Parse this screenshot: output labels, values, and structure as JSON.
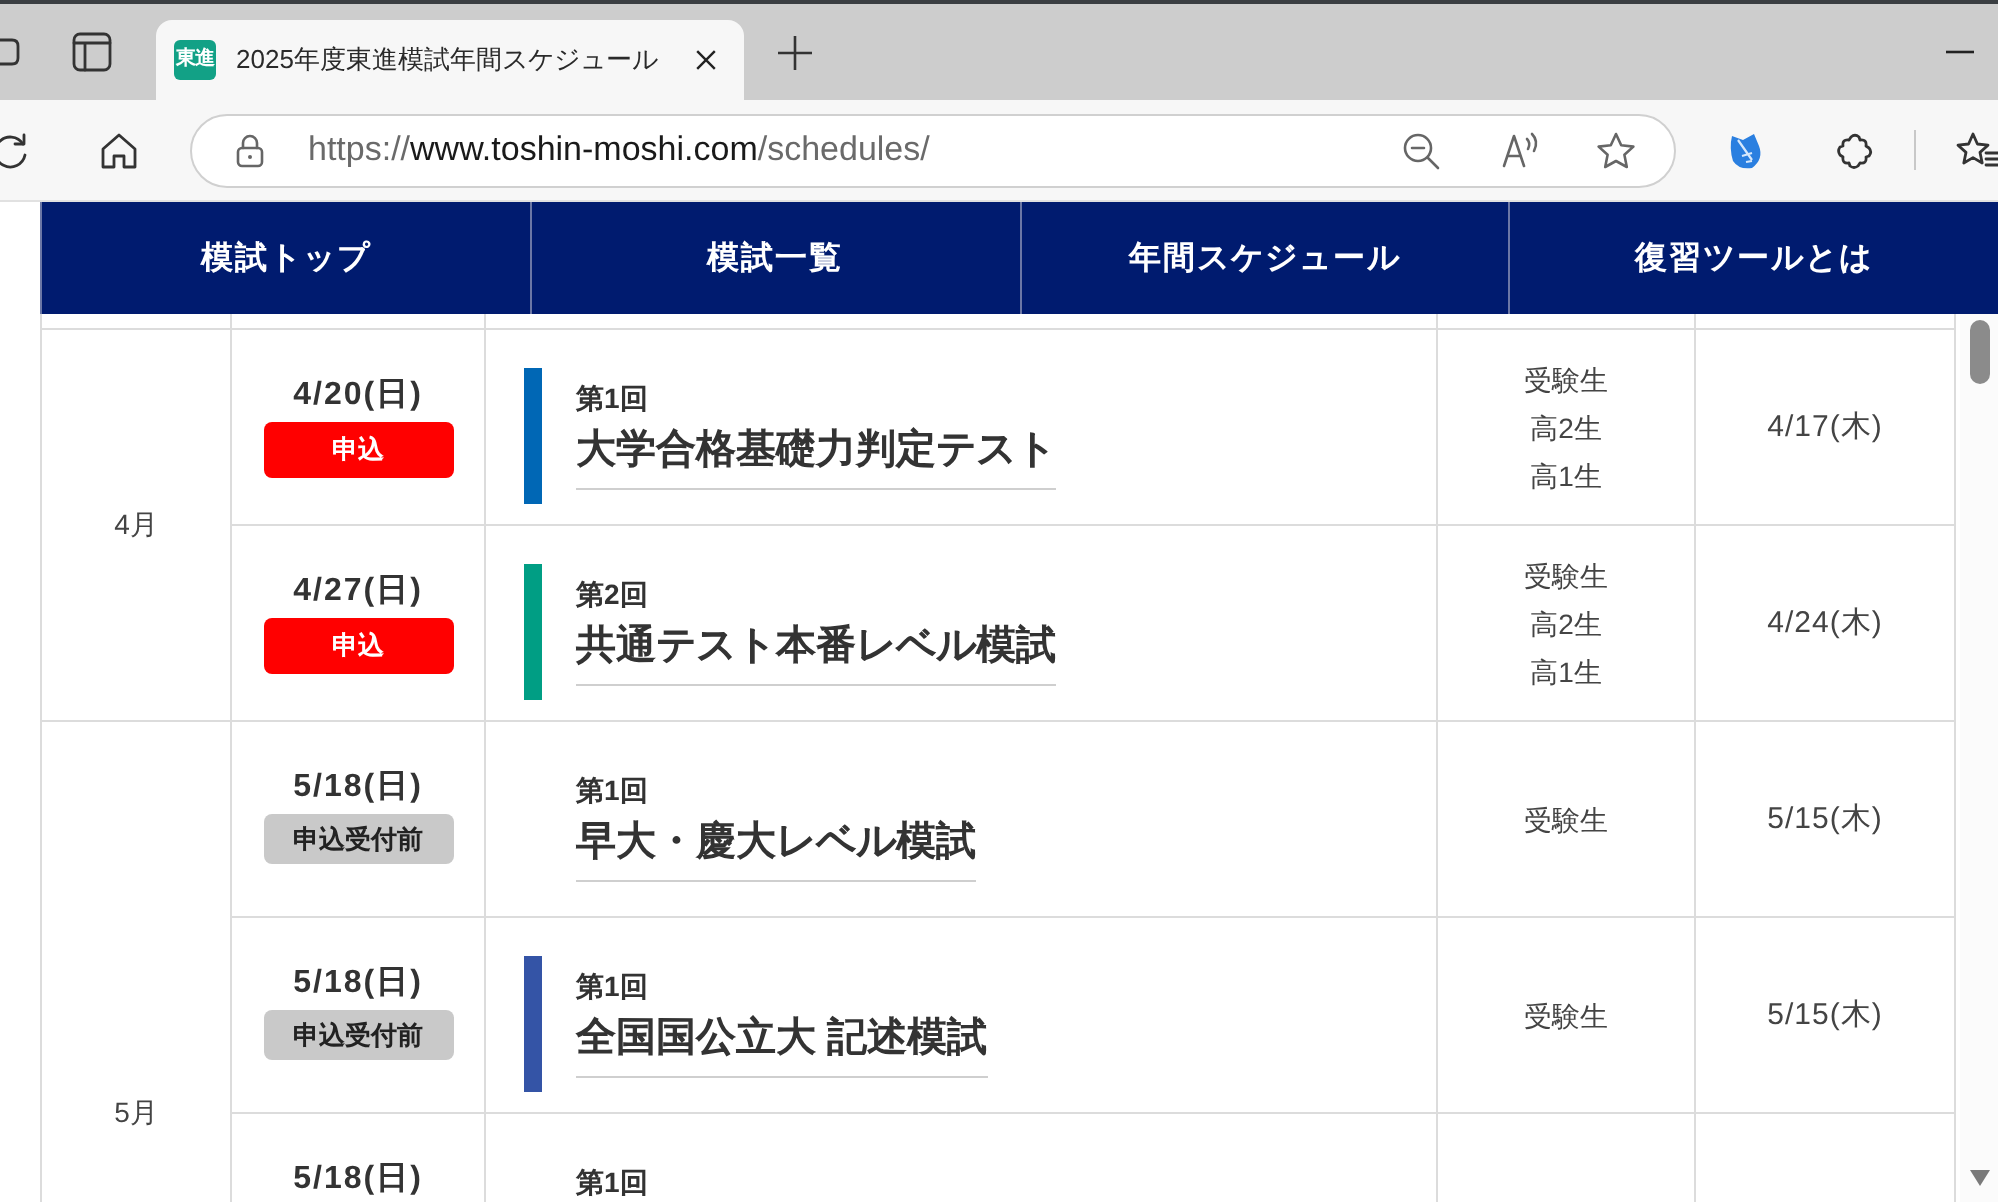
{
  "browser": {
    "tab": {
      "favicon_label": "東進",
      "title": "2025年度東進模試年間スケジュール"
    },
    "address_bar": {
      "scheme": "https://",
      "host": "www.toshin-moshi.com",
      "path": "/schedules/"
    }
  },
  "nav": [
    {
      "label": "模試トップ"
    },
    {
      "label": "模試一覧"
    },
    {
      "label": "年間スケジュール"
    },
    {
      "label": "復習ツールとは"
    }
  ],
  "schedule": {
    "months": [
      {
        "month": "4月",
        "rows": [
          {
            "date": "4/20(日)",
            "badge": {
              "kind": "open",
              "label": "申込"
            },
            "round": "第1回",
            "title": "大学合格基礎力判定テスト",
            "color": "#0067b5",
            "grades": [
              "受験生",
              "高2生",
              "高1生"
            ],
            "deadline": "4/17(木)"
          },
          {
            "date": "4/27(日)",
            "badge": {
              "kind": "open",
              "label": "申込"
            },
            "round": "第2回",
            "title": "共通テスト本番レベル模試",
            "color": "#009e84",
            "grades": [
              "受験生",
              "高2生",
              "高1生"
            ],
            "deadline": "4/24(木)"
          }
        ]
      },
      {
        "month": "5月",
        "rows": [
          {
            "date": "5/18(日)",
            "badge": {
              "kind": "pending",
              "label": "申込受付前"
            },
            "round": "第1回",
            "title": "早大・慶大レベル模試",
            "grades": [
              "受験生"
            ],
            "deadline": "5/15(木)"
          },
          {
            "date": "5/18(日)",
            "badge": {
              "kind": "pending",
              "label": "申込受付前"
            },
            "round": "第1回",
            "title": "全国国公立大 記述模試",
            "color": "#3454a6",
            "grades": [
              "受験生"
            ],
            "deadline": "5/15(木)"
          },
          {
            "date": "5/18(日)",
            "round": "第1回"
          }
        ]
      }
    ]
  }
}
